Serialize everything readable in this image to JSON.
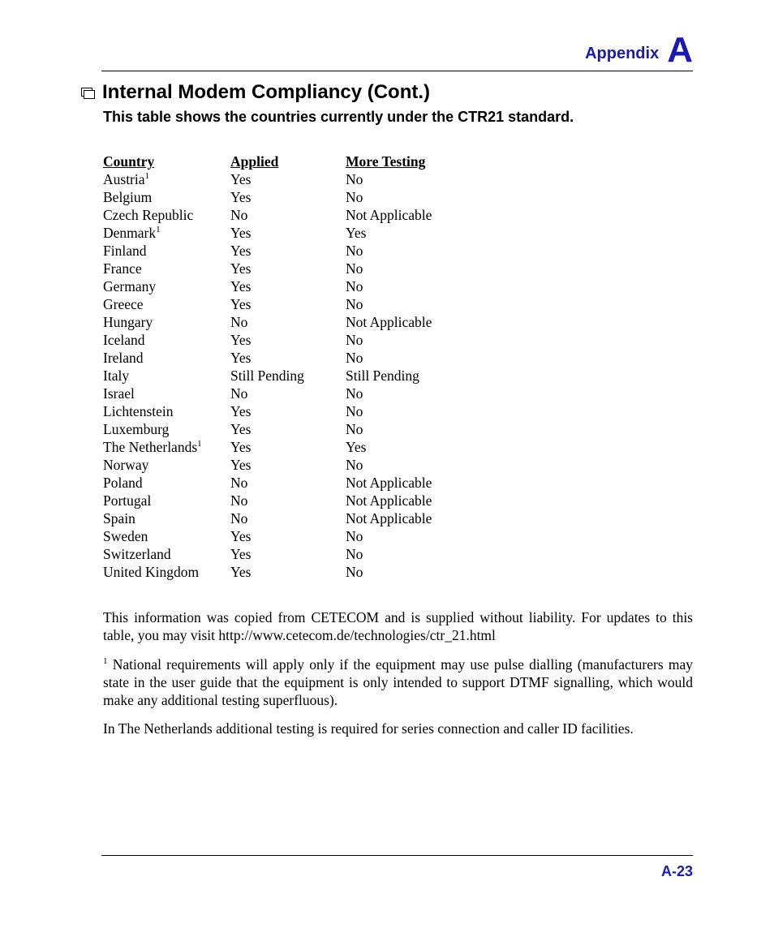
{
  "header": {
    "label": "Appendix",
    "letter": "A"
  },
  "title": "Internal Modem Compliancy (Cont.)",
  "subtitle": "This table shows the countries currently under the CTR21 standard.",
  "table": {
    "headers": {
      "country": "Country",
      "applied": "Applied",
      "more": "More Testing"
    },
    "rows": [
      {
        "country": "Austria",
        "sup": "1",
        "applied": "Yes",
        "more": "No"
      },
      {
        "country": "Belgium",
        "applied": "Yes",
        "more": "No"
      },
      {
        "country": "Czech Republic",
        "applied": "No",
        "more": "Not Applicable"
      },
      {
        "country": "Denmark",
        "sup": "1",
        "applied": "Yes",
        "more": "Yes"
      },
      {
        "country": "Finland",
        "applied": "Yes",
        "more": "No"
      },
      {
        "country": "France",
        "applied": "Yes",
        "more": "No"
      },
      {
        "country": "Germany",
        "applied": "Yes",
        "more": "No"
      },
      {
        "country": "Greece",
        "applied": "Yes",
        "more": "No"
      },
      {
        "country": "Hungary",
        "applied": "No",
        "more": "Not Applicable"
      },
      {
        "country": "Iceland",
        "applied": "Yes",
        "more": "No"
      },
      {
        "country": "Ireland",
        "applied": "Yes",
        "more": "No"
      },
      {
        "country": "Italy",
        "applied": "Still Pending",
        "more": "Still Pending"
      },
      {
        "country": "Israel",
        "applied": "No",
        "more": "No"
      },
      {
        "country": "Lichtenstein",
        "applied": "Yes",
        "more": "No"
      },
      {
        "country": "Luxemburg",
        "applied": "Yes",
        "more": "No"
      },
      {
        "country": "The Netherlands",
        "sup": "1",
        "applied": "Yes",
        "more": "Yes"
      },
      {
        "country": "Norway",
        "applied": "Yes",
        "more": "No"
      },
      {
        "country": "Poland",
        "applied": "No",
        "more": "Not Applicable"
      },
      {
        "country": "Portugal",
        "applied": "No",
        "more": "Not Applicable"
      },
      {
        "country": "Spain",
        "applied": "No",
        "more": "Not Applicable"
      },
      {
        "country": "Sweden",
        "applied": "Yes",
        "more": "No"
      },
      {
        "country": "Switzerland",
        "applied": "Yes",
        "more": "No"
      },
      {
        "country": "United Kingdom",
        "applied": "Yes",
        "more": "No"
      }
    ]
  },
  "paragraphs": {
    "p1": "This information was copied from CETECOM and is supplied without liability. For updates to this table, you may visit http://www.cetecom.de/technologies/ctr_21.html",
    "p2_sup": "1",
    "p2": " National requirements will apply only if the equipment may use pulse dialling (manufacturers may state in the user guide that the equipment is only intended to support DTMF signalling, which would make any additional testing superfluous).",
    "p3": "In The Netherlands additional testing is required for series connection and caller ID facilities."
  },
  "page_number": "A-23"
}
